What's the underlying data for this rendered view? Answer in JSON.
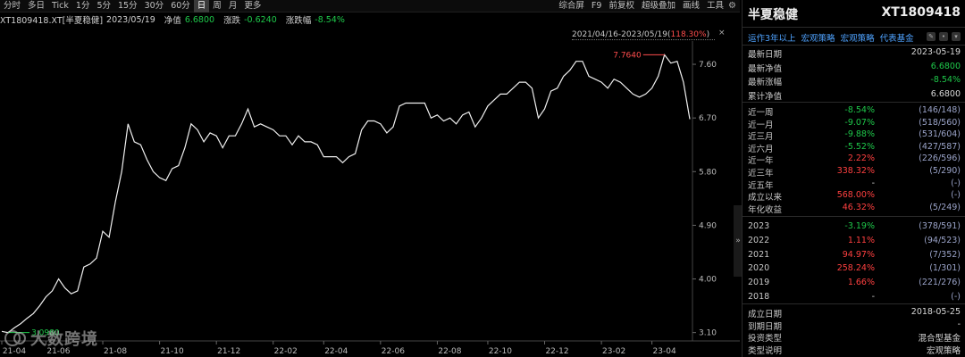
{
  "toolbar": {
    "left": [
      "分时",
      "多日",
      "Tick",
      "1分",
      "5分",
      "15分",
      "30分",
      "60分",
      "日",
      "周",
      "月",
      "更多"
    ],
    "active": "日",
    "right": [
      "综合屏",
      "F9",
      "前复权",
      "超级叠加",
      "画线",
      "工具"
    ]
  },
  "info": {
    "code_name": "XT1809418.XT[半夏稳健]",
    "date": "2023/05/19",
    "nav_label": "净值",
    "nav_value": "6.6800",
    "change_label": "涨跌",
    "change_value": "-0.6240",
    "change_pct_label": "涨跌幅",
    "change_pct_value": "-8.54%"
  },
  "range": {
    "text": "2021/04/16-2023/05/19(",
    "pct": "118.30%",
    "close": ")"
  },
  "watermark": {
    "text": "大数跨境"
  },
  "panel": {
    "name": "半夏稳健",
    "code": "XT1809418",
    "tags": [
      "运作3年以上",
      "宏观策略",
      "宏观策略",
      "代表基金"
    ],
    "basic": [
      {
        "k": "最新日期",
        "v": "2023-05-19",
        "color": "#d8d8d8"
      },
      {
        "k": "最新净值",
        "v": "6.6800",
        "color": "#1ec84a"
      },
      {
        "k": "最新涨幅",
        "v": "-8.54%",
        "color": "#1ec84a"
      },
      {
        "k": "累计净值",
        "v": "6.6800",
        "color": "#d8d8d8"
      }
    ],
    "periods": [
      {
        "k": "近一周",
        "c": "-8.54%",
        "r": "(146/148)",
        "color": "#1ec84a"
      },
      {
        "k": "近一月",
        "c": "-9.07%",
        "r": "(518/560)",
        "color": "#1ec84a"
      },
      {
        "k": "近三月",
        "c": "-9.88%",
        "r": "(531/604)",
        "color": "#1ec84a"
      },
      {
        "k": "近六月",
        "c": "-5.52%",
        "r": "(427/587)",
        "color": "#1ec84a"
      },
      {
        "k": "近一年",
        "c": "2.22%",
        "r": "(226/596)",
        "color": "#ff4040"
      },
      {
        "k": "近三年",
        "c": "338.32%",
        "r": "(5/290)",
        "color": "#ff4040"
      },
      {
        "k": "近五年",
        "c": "-",
        "r": "(-)",
        "color": "#c8c8c8"
      },
      {
        "k": "成立以来",
        "c": "568.00%",
        "r": "(-)",
        "color": "#ff4040"
      },
      {
        "k": "年化收益",
        "c": "46.32%",
        "r": "(5/249)",
        "color": "#ff4040"
      }
    ],
    "years": [
      {
        "k": "2023",
        "c": "-3.19%",
        "r": "(378/591)",
        "color": "#1ec84a"
      },
      {
        "k": "2022",
        "c": "1.11%",
        "r": "(94/523)",
        "color": "#ff4040"
      },
      {
        "k": "2021",
        "c": "94.97%",
        "r": "(7/352)",
        "color": "#ff4040"
      },
      {
        "k": "2020",
        "c": "258.24%",
        "r": "(1/301)",
        "color": "#ff4040"
      },
      {
        "k": "2019",
        "c": "1.66%",
        "r": "(221/276)",
        "color": "#ff4040"
      },
      {
        "k": "2018",
        "c": "-",
        "r": "(-)",
        "color": "#c8c8c8"
      }
    ],
    "bottom": [
      {
        "k": "成立日期",
        "v": "2018-05-25"
      },
      {
        "k": "到期日期",
        "v": "-"
      },
      {
        "k": "投资类型",
        "v": "混合型基金"
      },
      {
        "k": "类型说明",
        "v": "宏观策略"
      }
    ]
  },
  "chart_data": {
    "type": "line",
    "series": [
      {
        "x": [
          "21-04-16",
          "21-04-25",
          "21-05-01",
          "21-05-08",
          "21-05-15",
          "21-05-22",
          "21-05-29",
          "21-06-05",
          "21-06-12",
          "21-06-19",
          "21-06-26",
          "21-07-03",
          "21-07-10",
          "21-07-17",
          "21-07-24",
          "21-07-31",
          "21-08-07",
          "21-08-14",
          "21-08-21",
          "21-08-28",
          "21-09-04",
          "21-09-11",
          "21-09-18",
          "21-09-25",
          "21-10-02",
          "21-10-09",
          "21-10-16",
          "21-10-23",
          "21-10-30",
          "21-11-06",
          "21-11-13",
          "21-11-20",
          "21-11-27",
          "21-12-04",
          "21-12-11",
          "21-12-18",
          "21-12-25",
          "22-01-01",
          "22-01-08",
          "22-01-15",
          "22-01-22",
          "22-01-29",
          "22-02-05",
          "22-02-12",
          "22-02-19",
          "22-02-26",
          "22-03-05",
          "22-03-12",
          "22-03-19",
          "22-03-26",
          "22-04-02",
          "22-04-09",
          "22-04-16",
          "22-04-23",
          "22-04-30",
          "22-05-07",
          "22-05-14",
          "22-05-21",
          "22-05-28",
          "22-06-04",
          "22-06-11",
          "22-06-18",
          "22-06-25",
          "22-07-02",
          "22-07-09",
          "22-07-16",
          "22-07-23",
          "22-07-30",
          "22-08-06",
          "22-08-13",
          "22-08-20",
          "22-08-27",
          "22-09-03",
          "22-09-10",
          "22-09-17",
          "22-09-24",
          "22-10-01",
          "22-10-08",
          "22-10-15",
          "22-10-22",
          "22-10-29",
          "22-11-05",
          "22-11-12",
          "22-11-19",
          "22-11-26",
          "22-12-03",
          "22-12-10",
          "22-12-17",
          "22-12-24",
          "22-12-31",
          "23-01-07",
          "23-01-14",
          "23-01-21",
          "23-01-28",
          "23-02-04",
          "23-02-11",
          "23-02-18",
          "23-02-25",
          "23-03-04",
          "23-03-11",
          "23-03-18",
          "23-03-25",
          "23-04-01",
          "23-04-08",
          "23-04-15",
          "23-04-22",
          "23-04-29",
          "23-05-06",
          "23-05-12",
          "23-05-19"
        ],
        "y": [
          3.12,
          3.1,
          3.18,
          3.25,
          3.34,
          3.42,
          3.55,
          3.7,
          3.8,
          4.0,
          3.85,
          3.75,
          3.8,
          4.2,
          4.25,
          4.35,
          4.8,
          4.7,
          5.3,
          5.8,
          6.6,
          6.3,
          6.25,
          6.0,
          5.8,
          5.7,
          5.65,
          5.85,
          5.9,
          6.2,
          6.6,
          6.5,
          6.3,
          6.45,
          6.4,
          6.2,
          6.4,
          6.4,
          6.6,
          6.85,
          6.55,
          6.6,
          6.55,
          6.5,
          6.4,
          6.4,
          6.25,
          6.4,
          6.3,
          6.3,
          6.25,
          6.05,
          6.05,
          6.05,
          5.95,
          6.05,
          6.1,
          6.5,
          6.65,
          6.65,
          6.6,
          6.45,
          6.55,
          6.9,
          6.95,
          6.95,
          6.95,
          6.95,
          6.7,
          6.75,
          6.65,
          6.7,
          6.6,
          6.75,
          6.8,
          6.55,
          6.7,
          6.9,
          7.0,
          7.1,
          7.1,
          7.2,
          7.3,
          7.3,
          7.2,
          6.7,
          6.85,
          7.15,
          7.2,
          7.4,
          7.5,
          7.65,
          7.65,
          7.4,
          7.35,
          7.3,
          7.2,
          7.35,
          7.3,
          7.2,
          7.1,
          7.05,
          7.1,
          7.2,
          7.4,
          7.76,
          7.62,
          7.65,
          7.3,
          6.68
        ]
      }
    ],
    "ylim": [
      3.05,
      7.9
    ],
    "yticks": [
      "7.60",
      "6.70",
      "5.80",
      "4.90",
      "4.00",
      "3.10"
    ],
    "xticks": [
      {
        "label": "21-04",
        "x": "21-04-16"
      },
      {
        "label": "21-06",
        "x": "21-06-05"
      },
      {
        "label": "21-08",
        "x": "21-08-07"
      },
      {
        "label": "21-10",
        "x": "21-10-09"
      },
      {
        "label": "21-12",
        "x": "21-12-11"
      },
      {
        "label": "22-02",
        "x": "22-02-12"
      },
      {
        "label": "22-04",
        "x": "22-04-09"
      },
      {
        "label": "22-06",
        "x": "22-06-11"
      },
      {
        "label": "22-08",
        "x": "22-08-13"
      },
      {
        "label": "22-10",
        "x": "22-10-08"
      },
      {
        "label": "22-12",
        "x": "22-12-10"
      },
      {
        "label": "23-02",
        "x": "23-02-11"
      },
      {
        "label": "23-04",
        "x": "23-04-08"
      }
    ],
    "max_label": "7.7640",
    "min_label": "3.0980",
    "grid": false
  }
}
